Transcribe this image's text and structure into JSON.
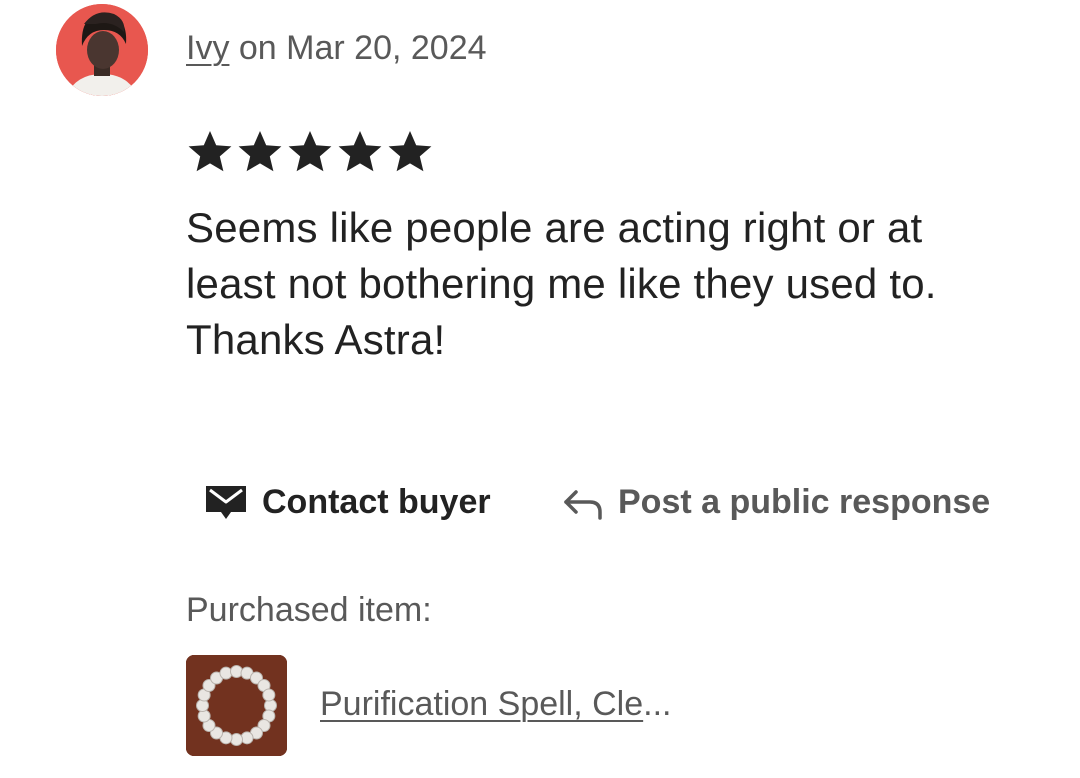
{
  "review": {
    "reviewer_name": "Ivy",
    "date_text": " on Mar 20, 2024",
    "rating": 5,
    "rating_max": 5,
    "text": "Seems like people are acting right or at least not bothering me like they used to. Thanks Astra!"
  },
  "actions": {
    "contact_label": "Contact buyer",
    "contact_icon": "envelope-icon",
    "response_label": "Post a public response",
    "response_icon": "reply-arrow-icon"
  },
  "purchased": {
    "label": "Purchased item:",
    "item_title": "Purification Spell, Cle",
    "item_ellipsis": "..."
  },
  "colors": {
    "text_primary": "#222222",
    "text_secondary": "#595959",
    "avatar_background": "#e8574f",
    "thumbnail_background": "#6b2e1d"
  }
}
